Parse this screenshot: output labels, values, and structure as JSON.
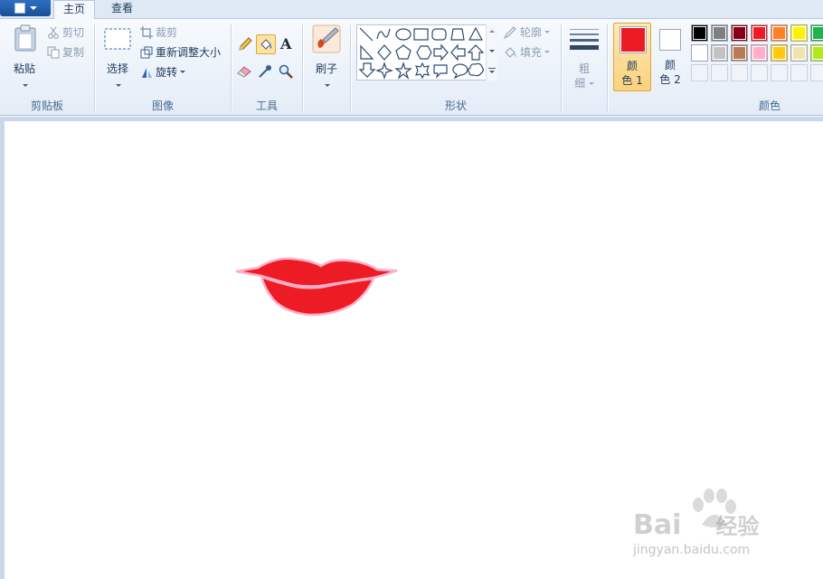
{
  "tabs": [
    {
      "label": "主页",
      "active": true
    },
    {
      "label": "查看",
      "active": false
    }
  ],
  "clipboard": {
    "paste_label": "粘贴",
    "cut_label": "剪切",
    "copy_label": "复制",
    "group_label": "剪贴板"
  },
  "image": {
    "select_label": "选择",
    "crop_label": "裁剪",
    "resize_label": "重新调整大小",
    "rotate_label": "旋转",
    "group_label": "图像"
  },
  "tools": {
    "group_label": "工具",
    "items": [
      {
        "icon": "pencil-icon",
        "active": false
      },
      {
        "icon": "fill-bucket-icon",
        "active": true
      },
      {
        "icon": "text-icon",
        "active": false,
        "glyph": "A"
      },
      {
        "icon": "eraser-icon",
        "active": false
      },
      {
        "icon": "color-picker-icon",
        "active": false
      },
      {
        "icon": "magnifier-icon",
        "active": false
      }
    ]
  },
  "brushes": {
    "label": "刷子"
  },
  "shapes": {
    "group_label": "形状",
    "outline_label": "轮廓",
    "fill_label": "填充"
  },
  "size": {
    "label_line1": "粗",
    "label_line2": "细"
  },
  "colors": {
    "group_label": "颜色",
    "color1_label_line1": "颜",
    "color1_label_line2": "色 1",
    "color2_label_line1": "颜",
    "color2_label_line2": "色 2",
    "color1_value": "#ed1c24",
    "color2_value": "#ffffff",
    "palette_row1": [
      "#000000",
      "#7f7f7f",
      "#880015",
      "#ed1c24",
      "#ff7f27",
      "#fff200",
      "#22b14c"
    ],
    "palette_row2": [
      "#ffffff",
      "#c3c3c3",
      "#b97a57",
      "#ffaec9",
      "#ffc90e",
      "#efe4b0",
      "#b5e61d"
    ],
    "palette_row3": [
      "#f0f4f9",
      "#f0f4f9",
      "#f0f4f9",
      "#f0f4f9",
      "#f0f4f9",
      "#f0f4f9",
      "#f0f4f9"
    ]
  },
  "canvas": {
    "drawing": "lips",
    "lip_fill": "#ed1c24",
    "lip_outline": "#ffaec9"
  },
  "watermark": {
    "brand": "Bai",
    "brand_suffix": "经验",
    "url": "jingyan.baidu.com"
  }
}
